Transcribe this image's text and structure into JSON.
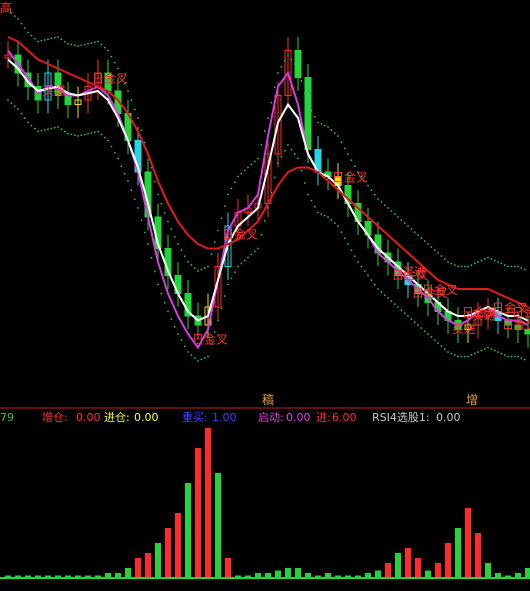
{
  "colors": {
    "background": "#000000",
    "ma_long": "#e31a1a",
    "ma_mid": "#ffffff",
    "ma_short": "#d63ce0",
    "dotted_band": "#22c45a",
    "bull_candle": "#ff2b2b",
    "bear_candle": "#22d63a",
    "cyan_candle": "#27d6e6",
    "yellow_candle": "#f0e000",
    "label_red": "#ff3030",
    "separator": "#c81e1e"
  },
  "price_panel": {
    "signal_labels": [
      "日金叉",
      "买进",
      "日金叉",
      "日金叉",
      "日金叉",
      "日金叉",
      "买进",
      "日金叉",
      "日金叉",
      "买进",
      "日金叉",
      "买进",
      "日金叉",
      "日金叉",
      "日金叉"
    ],
    "markers": [
      "稿",
      "增"
    ],
    "left_cut_label": "高"
  },
  "indicator_bar": {
    "left_value": "79",
    "items": [
      {
        "name": "增仓:",
        "value": "0.00",
        "color": "#ff3030"
      },
      {
        "name": "进仓:",
        "value": "0.00",
        "color": "#ffff40"
      },
      {
        "name": "重买:",
        "value": "1.00",
        "color": "#4040ff"
      },
      {
        "name": "启动:",
        "value": "0.00",
        "color": "#e040e0"
      },
      {
        "name": "进:",
        "value": "6.00",
        "color": "#ff3030"
      },
      {
        "name": "RSI4选股1:",
        "value": "0.00",
        "color": "#c8c8c8"
      }
    ]
  },
  "chart_data": [
    {
      "type": "line",
      "description_series": [
        "price_close",
        "ma_short",
        "ma_mid",
        "ma_long"
      ],
      "x": [
        0,
        10,
        20,
        30,
        40,
        50,
        60,
        70,
        80,
        90,
        100,
        110,
        120,
        130,
        140,
        150,
        160,
        170,
        180,
        190,
        200,
        210,
        220,
        230,
        240,
        250,
        260,
        270,
        280,
        290,
        300,
        310,
        320,
        330,
        340,
        350,
        360,
        370,
        380,
        390,
        400,
        410,
        420,
        430,
        440,
        450,
        460,
        470,
        480,
        490,
        500,
        510,
        520
      ],
      "series": [
        {
          "name": "price",
          "values": [
            80,
            72,
            66,
            60,
            72,
            62,
            58,
            60,
            66,
            72,
            64,
            54,
            42,
            28,
            8,
            -6,
            -18,
            -26,
            -36,
            -40,
            -32,
            -14,
            4,
            10,
            12,
            14,
            36,
            62,
            82,
            70,
            38,
            28,
            26,
            22,
            14,
            6,
            0,
            -8,
            -12,
            -18,
            -22,
            -26,
            -30,
            -34,
            -38,
            -42,
            -40,
            -36,
            -34,
            -38,
            -40,
            -42,
            -44
          ]
        },
        {
          "name": "ma_short",
          "values": [
            82,
            76,
            70,
            63,
            66,
            65,
            62,
            62,
            64,
            66,
            62,
            54,
            42,
            28,
            8,
            -12,
            -26,
            -36,
            -44,
            -50,
            -42,
            -20,
            2,
            10,
            12,
            18,
            44,
            66,
            72,
            58,
            36,
            28,
            26,
            22,
            14,
            6,
            0,
            -8,
            -12,
            -16,
            -20,
            -24,
            -28,
            -34,
            -38,
            -40,
            -38,
            -34,
            -32,
            -36,
            -38,
            -38,
            -40
          ]
        },
        {
          "name": "ma_mid",
          "values": [
            78,
            74,
            68,
            64,
            65,
            66,
            63,
            62,
            63,
            64,
            60,
            52,
            42,
            30,
            14,
            -4,
            -16,
            -26,
            -34,
            -38,
            -36,
            -20,
            -4,
            4,
            8,
            12,
            30,
            50,
            58,
            52,
            36,
            28,
            26,
            22,
            14,
            6,
            0,
            -6,
            -10,
            -14,
            -18,
            -22,
            -26,
            -30,
            -34,
            -36,
            -36,
            -34,
            -32,
            -34,
            -36,
            -36,
            -38
          ]
        },
        {
          "name": "ma_long",
          "values": [
            88,
            86,
            82,
            78,
            76,
            74,
            72,
            70,
            68,
            66,
            64,
            60,
            54,
            46,
            36,
            24,
            14,
            6,
            0,
            -4,
            -6,
            -6,
            -4,
            -2,
            2,
            6,
            14,
            22,
            28,
            30,
            30,
            28,
            24,
            20,
            16,
            12,
            8,
            4,
            0,
            -4,
            -8,
            -12,
            -16,
            -20,
            -22,
            -24,
            -24,
            -24,
            -24,
            -26,
            -28,
            -30,
            -32
          ]
        }
      ]
    },
    {
      "type": "bar",
      "description": "volume-style indicator histogram (lower panel), heights in indicator units",
      "x": [
        0,
        10,
        20,
        30,
        40,
        50,
        60,
        70,
        80,
        90,
        100,
        110,
        120,
        130,
        140,
        150,
        160,
        170,
        180,
        190,
        200,
        210,
        220,
        230,
        240,
        250,
        260,
        270,
        280,
        290,
        300,
        310,
        320,
        330,
        340,
        350,
        360,
        370,
        380,
        390,
        400,
        410,
        420,
        430,
        440,
        450,
        460,
        470,
        480,
        490,
        500,
        510,
        520
      ],
      "values": [
        1,
        1,
        1,
        1,
        1,
        1,
        1,
        1,
        1,
        1,
        2,
        2,
        4,
        8,
        10,
        14,
        20,
        26,
        38,
        52,
        60,
        42,
        8,
        1,
        1,
        2,
        2,
        3,
        4,
        4,
        2,
        1,
        2,
        1,
        1,
        1,
        2,
        3,
        6,
        10,
        12,
        8,
        3,
        6,
        14,
        20,
        28,
        18,
        6,
        2,
        1,
        2,
        4
      ]
    }
  ]
}
